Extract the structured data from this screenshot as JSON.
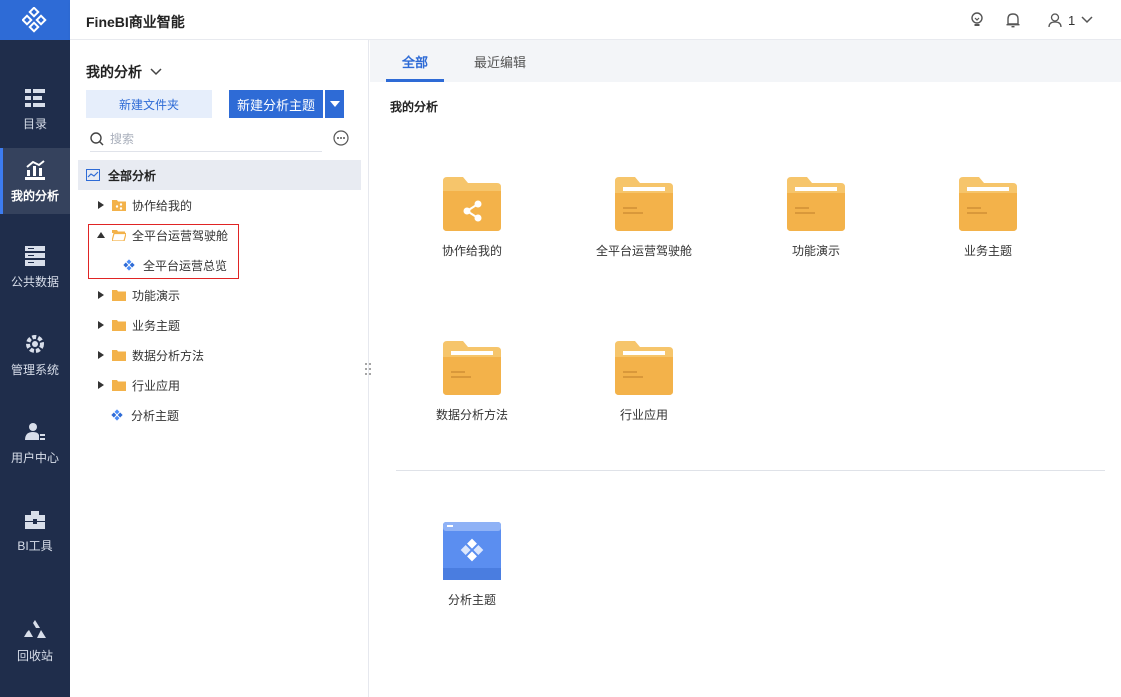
{
  "app": {
    "title": "FineBI商业智能"
  },
  "nav": {
    "items": [
      {
        "label": "目录",
        "icon": "catalog-icon"
      },
      {
        "label": "我的分析",
        "icon": "analysis-icon",
        "active": true
      },
      {
        "label": "公共数据",
        "icon": "data-icon"
      },
      {
        "label": "管理系统",
        "icon": "gear-icon"
      },
      {
        "label": "用户中心",
        "icon": "user-center-icon"
      },
      {
        "label": "BI工具",
        "icon": "toolbox-icon"
      },
      {
        "label": "回收站",
        "icon": "recycle-icon"
      }
    ]
  },
  "header": {
    "user": "1",
    "icons": [
      "lightbulb-icon",
      "bell-icon",
      "user-icon"
    ]
  },
  "panel": {
    "title": "我的分析",
    "new_folder": "新建文件夹",
    "new_subject": "新建分析主题",
    "search_placeholder": "搜索",
    "tree": {
      "root": "全部分析",
      "items": [
        "协作给我的",
        "全平台运营驾驶舱",
        "全平台运营总览",
        "功能演示",
        "业务主题",
        "数据分析方法",
        "行业应用",
        "分析主题"
      ]
    }
  },
  "main": {
    "tabs": [
      "全部",
      "最近编辑"
    ],
    "section_title": "我的分析",
    "folders": [
      "协作给我的",
      "全平台运营驾驶舱",
      "功能演示",
      "业务主题",
      "数据分析方法",
      "行业应用"
    ],
    "subjects": [
      "分析主题"
    ]
  },
  "colors": {
    "accent": "#2e6bd6",
    "rail": "#1f2d4b",
    "folder": "#f3b24a",
    "highlight": "#e02424"
  }
}
